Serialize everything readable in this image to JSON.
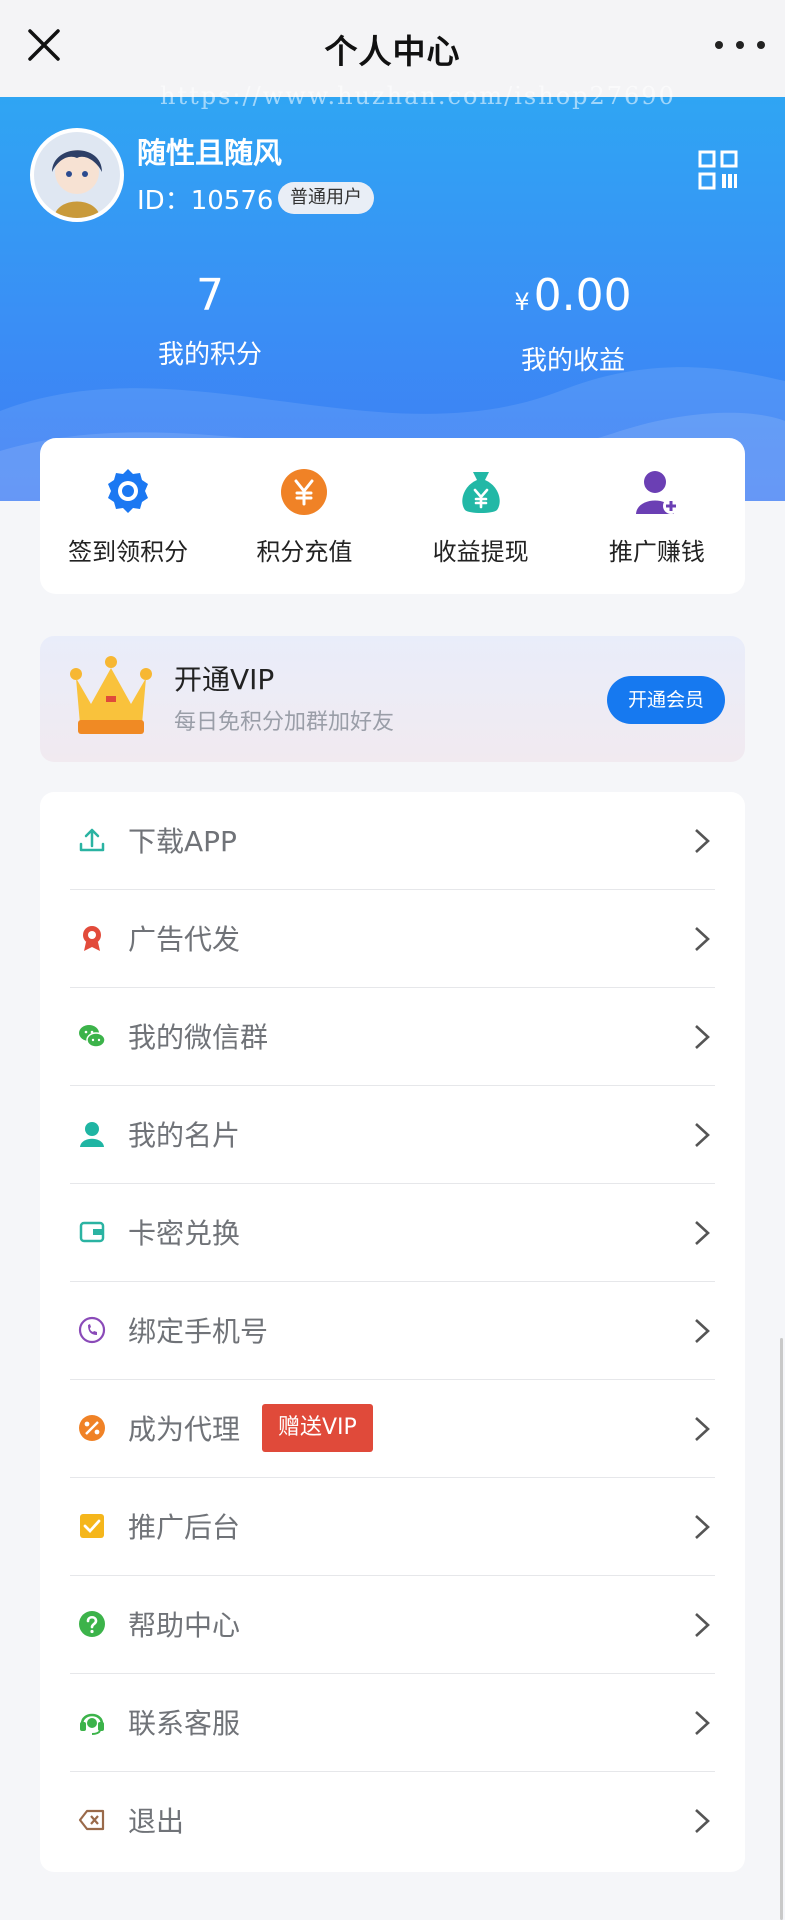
{
  "nav": {
    "title": "个人中心"
  },
  "watermark": "https://www.huzhan.com/ishop27690",
  "profile": {
    "name": "随性且随风",
    "id_label": "ID：",
    "id": "10576",
    "badge": "普通用户"
  },
  "stats": [
    {
      "value": "7",
      "label": "我的积分"
    },
    {
      "currency": "¥",
      "value": "0.00",
      "label": "我的收益"
    }
  ],
  "actions": [
    {
      "label": "签到领积分",
      "icon": "badge-icon",
      "color": "#1b78f2"
    },
    {
      "label": "积分充值",
      "icon": "yen-coin-icon",
      "color": "#f08226"
    },
    {
      "label": "收益提现",
      "icon": "money-bag-icon",
      "color": "#22b8a6"
    },
    {
      "label": "推广赚钱",
      "icon": "user-add-icon",
      "color": "#6b3fb4"
    }
  ],
  "vip": {
    "title": "开通VIP",
    "subtitle": "每日免积分加群加好友",
    "button": "开通会员"
  },
  "menu": [
    {
      "label": "下载APP",
      "icon": "upload-icon",
      "color": "#2ab3a2"
    },
    {
      "label": "广告代发",
      "icon": "award-icon",
      "color": "#e24b3b"
    },
    {
      "label": "我的微信群",
      "icon": "wechat-icon",
      "color": "#3cb34a"
    },
    {
      "label": "我的名片",
      "icon": "person-icon",
      "color": "#1fb5a3"
    },
    {
      "label": "卡密兑换",
      "icon": "wallet-icon",
      "color": "#2ab3a2"
    },
    {
      "label": "绑定手机号",
      "icon": "phone-icon",
      "color": "#8a4ab8"
    },
    {
      "label": "成为代理",
      "icon": "discount-icon",
      "color": "#f08226",
      "tag": "赠送VIP"
    },
    {
      "label": "推广后台",
      "icon": "checkbox-icon",
      "color": "#f5b61b"
    },
    {
      "label": "帮助中心",
      "icon": "help-icon",
      "color": "#3cb34a"
    },
    {
      "label": "联系客服",
      "icon": "headset-icon",
      "color": "#3cb34a"
    },
    {
      "label": "退出",
      "icon": "exit-icon",
      "color": "#9a6a4a"
    }
  ]
}
